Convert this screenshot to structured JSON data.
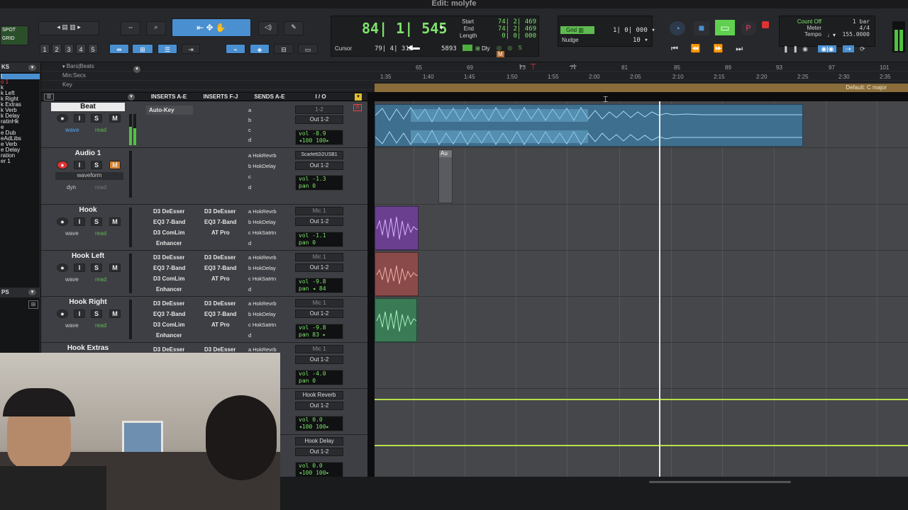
{
  "title": "Edit: molyfe",
  "toolbar": {
    "spot": "SPOT",
    "grid": "GRID",
    "zoom_presets": [
      "1",
      "2",
      "3",
      "4",
      "5"
    ],
    "counter_main": "84| 1| 545",
    "start_lbl": "Start",
    "end_lbl": "End",
    "length_lbl": "Length",
    "start_val": "74| 2| 469",
    "end_val": "74| 2| 469",
    "length_val": "0| 0| 000",
    "cursor_lbl": "Cursor",
    "cursor_val": "79| 4| 315",
    "sample_val": "5893",
    "dly": "Dly",
    "grid_lbl": "Grid",
    "grid_val": "1| 0| 000",
    "nudge_lbl": "Nudge",
    "nudge_val": "10",
    "count_off": "Count Off",
    "meter": "Meter",
    "tempo": "Tempo",
    "bars": "1 bar",
    "sig": "4/4",
    "tempo_val": "155.0000"
  },
  "rulers": {
    "bars_beats": "Bars|Beats",
    "min_secs": "Min:Secs",
    "key": "Key",
    "bar_ticks": [
      "65",
      "69",
      "73",
      "77",
      "81",
      "85",
      "89",
      "93",
      "97",
      "101"
    ],
    "time_ticks": [
      "1:35",
      "1:40",
      "1:45",
      "1:50",
      "1:55",
      "2:00",
      "2:05",
      "2:10",
      "2:15",
      "2:20",
      "2:25",
      "2:30",
      "2:35"
    ],
    "key_label": "Default: C major"
  },
  "left_list": {
    "tracks_header": "KS",
    "items": [
      "t",
      "o 1",
      "k",
      "k Left",
      "k Right",
      "k Extras",
      "k Verb",
      "k Delay",
      "ratinHk",
      "e",
      "e Dub",
      "eAdLibs",
      "e Verb",
      "e Delay",
      "ration",
      "er 1"
    ],
    "clips_header": "PS"
  },
  "columns": {
    "inserts_ae": "INSERTS A-E",
    "inserts_fj": "INSERTS F-J",
    "sends_ae": "SENDS A-E",
    "io": "I / O"
  },
  "tracks": [
    {
      "name": "Beat",
      "view": "wave",
      "mode": "read",
      "ins1": [
        "Auto-Key"
      ],
      "ins2": [],
      "sends": [
        "a",
        "b",
        "c",
        "d"
      ],
      "input": "1-2",
      "output": "Out 1-2",
      "vol": "-8.9",
      "pan": "◂100  100▸"
    },
    {
      "name": "Audio 1",
      "view": "waveform",
      "mode": "read",
      "dyn": "dyn",
      "ins1": [],
      "ins2": [],
      "sends": [
        "a HokRevrb",
        "b HokDelay",
        "c",
        "d"
      ],
      "input": "Scarlett2i2USB1",
      "output": "Out 1-2",
      "vol": "-1.3",
      "pan": "0"
    },
    {
      "name": "Hook",
      "view": "wave",
      "mode": "read",
      "ins1": [
        "D3 DeEsser",
        "EQ3 7-Band",
        "D3 ComLim",
        "Enhancer"
      ],
      "ins2": [
        "D3 DeEsser",
        "EQ3 7-Band",
        "AT Pro"
      ],
      "sends": [
        "a HokRevrb",
        "b HokDelay",
        "c HokSatrtn",
        "d"
      ],
      "input": "Mic 1",
      "output": "Out 1-2",
      "vol": "-1.1",
      "pan": "0"
    },
    {
      "name": "Hook Left",
      "view": "wave",
      "mode": "read",
      "ins1": [
        "D3 DeEsser",
        "EQ3 7-Band",
        "D3 ComLim",
        "Enhancer"
      ],
      "ins2": [
        "D3 DeEsser",
        "EQ3 7-Band",
        "AT Pro"
      ],
      "sends": [
        "a HokRevrb",
        "b HokDelay",
        "c HokSatrtn",
        "d"
      ],
      "input": "Mic 1",
      "output": "Out 1-2",
      "vol": "-9.8",
      "pan": "◂ 84"
    },
    {
      "name": "Hook Right",
      "view": "wave",
      "mode": "read",
      "ins1": [
        "D3 DeEsser",
        "EQ3 7-Band",
        "D3 ComLim",
        "Enhancer"
      ],
      "ins2": [
        "D3 DeEsser",
        "EQ3 7-Band",
        "AT Pro"
      ],
      "sends": [
        "a HokRevrb",
        "b HokDelay",
        "c HokSatrtn",
        "d"
      ],
      "input": "Mic 1",
      "output": "Out 1-2",
      "vol": "-9.8",
      "pan": "83 ▸"
    },
    {
      "name": "Hook Extras",
      "ins1": [
        "D3 DeEsser"
      ],
      "ins2": [
        "D3 DeEsser"
      ],
      "sends": [
        "a HokRevrb"
      ],
      "input": "Mic 1",
      "output": "Out 1-2",
      "vol": "-4.0",
      "pan": "0"
    },
    {
      "name": "",
      "input": "Hook Reverb",
      "output": "Out 1-2",
      "vol": "0.0",
      "pan": "◂100  100▸"
    },
    {
      "name": "",
      "input": "Hook Delay",
      "output": "Out 1-2",
      "vol": "0.0",
      "pan": "◂100  100▸"
    }
  ],
  "small_clip_label": "Au",
  "vol_lbl": "vol",
  "pan_lbl": "pan",
  "colors": {
    "beat": "#4f9fcc",
    "hook": "#9b5bd0",
    "hookleft": "#c86a6a",
    "hookright": "#4fb07a",
    "key": "#8a6d3b",
    "counter": "#7de36b"
  }
}
